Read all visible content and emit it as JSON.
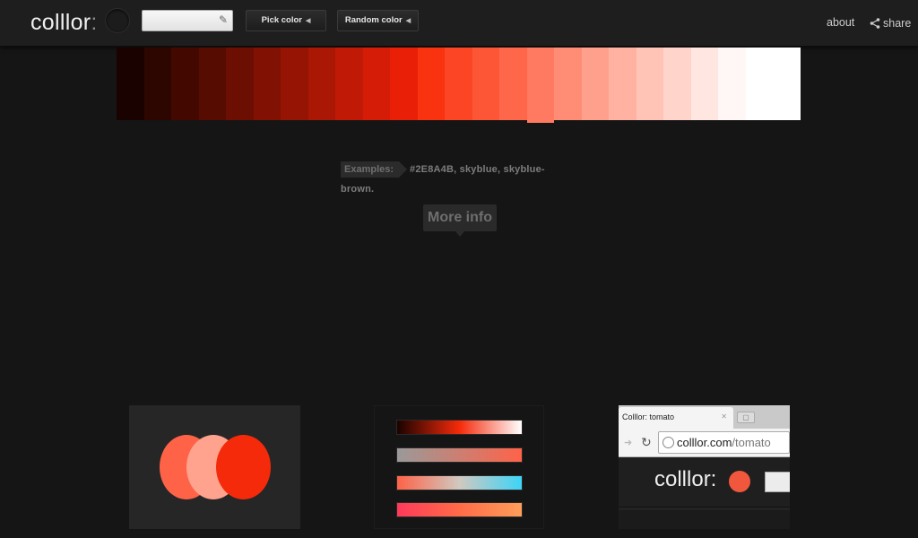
{
  "header": {
    "logo_text": "colllor",
    "logo_suffix": ":",
    "color_input_value": "",
    "pick_button": "Pick color",
    "random_button": "Random color",
    "nav_about": "about",
    "nav_share": "share"
  },
  "gradient": {
    "colors": [
      "#1a0200",
      "#2e0600",
      "#430900",
      "#570c02",
      "#6c0e02",
      "#811103",
      "#961404",
      "#ab1705",
      "#c01a06",
      "#d51c07",
      "#ea1f08",
      "#f93210",
      "#fb4524",
      "#fc5637",
      "#fe674a",
      "#ff7a60",
      "#ff8c75",
      "#ffa08c",
      "#ffb2a1",
      "#ffc4b6",
      "#ffd5cb",
      "#ffe6e0",
      "#fff7f5",
      "#ffffff",
      "#ffffff"
    ],
    "selected_index": 15
  },
  "examples": {
    "label": "Examples:",
    "items": [
      "#2E8A4B",
      "skyblue",
      "skyblue-brown"
    ],
    "line1": "#2E8A4B, skyblue, skyblue-",
    "line2": "brown."
  },
  "more_info": "More info",
  "panels": {
    "circles_colors": [
      "#fe6348",
      "#ffa28e",
      "#f52a0a"
    ],
    "bars_gradients": [
      [
        "#1a0200",
        "#f52a0a",
        "#ffffff"
      ],
      [
        "#9a9a9a",
        "#fe6348"
      ],
      [
        "#fe6348",
        "#d0c9c0",
        "#3ed4f8"
      ],
      [
        "#fe3a5a",
        "#ff6b48",
        "#ff9e5a"
      ]
    ],
    "browser": {
      "tab_title": "Colllor: tomato",
      "url_host": "colllor.com",
      "url_path": "/tomato",
      "inner_logo": "colllor:"
    }
  }
}
